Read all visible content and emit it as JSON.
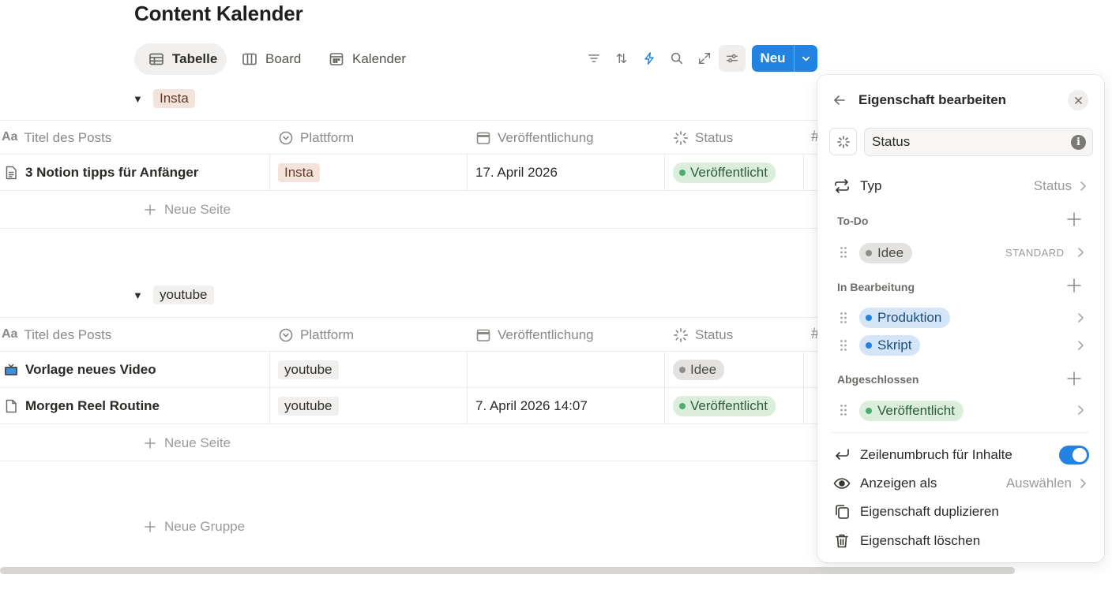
{
  "page": {
    "title": "Content Kalender"
  },
  "views": [
    {
      "label": "Tabelle",
      "icon": "table-icon",
      "active": true
    },
    {
      "label": "Board",
      "icon": "board-icon",
      "active": false
    },
    {
      "label": "Kalender",
      "icon": "calendar-icon",
      "active": false
    }
  ],
  "toolbar": {
    "icons": [
      "filter-icon",
      "sort-icon",
      "automation-icon",
      "search-icon",
      "expand-icon",
      "settings-sliders-icon"
    ],
    "new_label": "Neu",
    "accent": "#2383e2"
  },
  "columns": [
    "Titel des Posts",
    "Plattform",
    "Veröffentlichung",
    "Status"
  ],
  "groups": [
    {
      "name": "Insta",
      "pill_color": "#f4e3db",
      "rows": [
        {
          "icon": "page-icon",
          "title": "3 Notion tipps für Anfänger",
          "platform": "Insta",
          "date": "17. April 2026",
          "status": "Veröffentlicht"
        }
      ],
      "new_page": "Neue Seite"
    },
    {
      "name": "youtube",
      "pill_color": "#f1f0ee",
      "rows": [
        {
          "icon": "tv-icon",
          "title": "Vorlage neues Video",
          "platform": "youtube",
          "date": "",
          "status": "Idee"
        },
        {
          "icon": "page-icon",
          "title": "Morgen Reel Routine",
          "platform": "youtube",
          "date": "7. April 2026 14:07",
          "status": "Veröffentlicht"
        }
      ],
      "new_page": "Neue Seite"
    }
  ],
  "new_group": "Neue Gruppe",
  "status_colors": {
    "Veröffentlicht": {
      "bg": "#dbeddb",
      "dot": "#4dab6f",
      "text": "#2c5d3a"
    },
    "Idee": {
      "bg": "#e3e2e0",
      "dot": "#8f8e8a",
      "text": "#4a4945"
    },
    "Produktion": {
      "bg": "#d3e5f7",
      "dot": "#2383e2",
      "text": "#1c4c7a"
    },
    "Skript": {
      "bg": "#d3e5f7",
      "dot": "#2383e2",
      "text": "#1c4c7a"
    }
  },
  "panel": {
    "title": "Eigenschaft bearbeiten",
    "name_value": "Status",
    "type_label": "Typ",
    "type_value": "Status",
    "sections": [
      {
        "label": "To-Do",
        "options": [
          {
            "name": "Idee",
            "badge": "STANDARD"
          }
        ]
      },
      {
        "label": "In Bearbeitung",
        "options": [
          {
            "name": "Produktion",
            "badge": ""
          },
          {
            "name": "Skript",
            "badge": ""
          }
        ]
      },
      {
        "label": "Abgeschlossen",
        "options": [
          {
            "name": "Veröffentlicht",
            "badge": ""
          }
        ]
      }
    ],
    "wrap_label": "Zeilenumbruch für Inhalte",
    "wrap_on": true,
    "display_label": "Anzeigen als",
    "display_value": "Auswählen",
    "duplicate_label": "Eigenschaft duplizieren",
    "delete_label": "Eigenschaft löschen"
  }
}
